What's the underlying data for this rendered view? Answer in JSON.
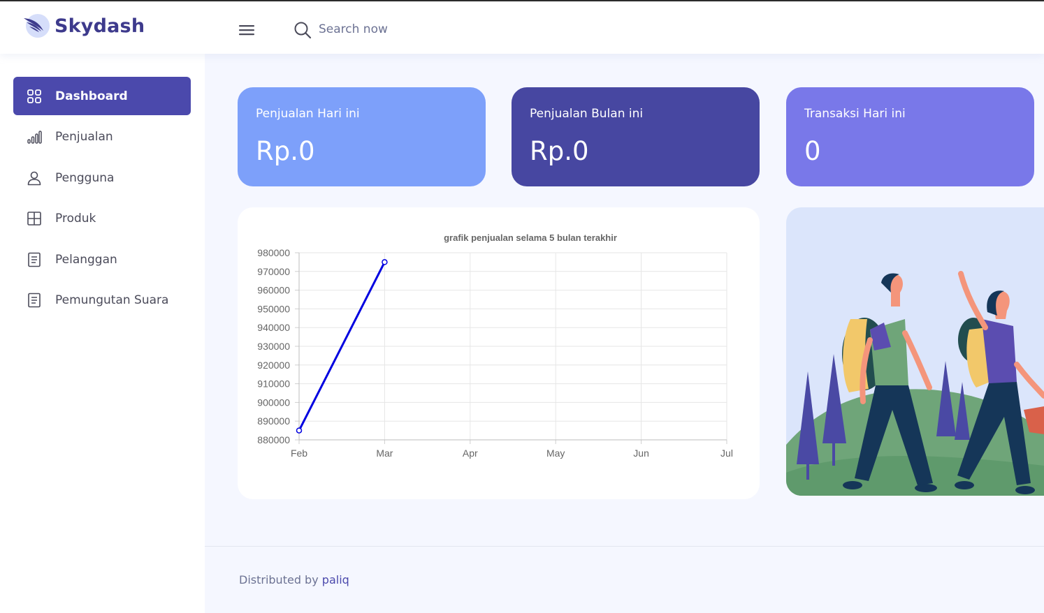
{
  "brand": {
    "name": "Skydash"
  },
  "search": {
    "placeholder": "Search now"
  },
  "sidebar": {
    "items": [
      {
        "label": "Dashboard",
        "icon": "grid-icon",
        "active": true
      },
      {
        "label": "Penjualan",
        "icon": "bar-chart-icon",
        "active": false
      },
      {
        "label": "Pengguna",
        "icon": "user-icon",
        "active": false
      },
      {
        "label": "Produk",
        "icon": "table-icon",
        "active": false
      },
      {
        "label": "Pelanggan",
        "icon": "document-icon",
        "active": false
      },
      {
        "label": "Pemungutan Suara",
        "icon": "document-icon",
        "active": false
      }
    ]
  },
  "cards": [
    {
      "title": "Penjualan Hari ini",
      "value": "Rp.0",
      "color": "#7da0fa"
    },
    {
      "title": "Penjualan Bulan ini",
      "value": "Rp.0",
      "color": "#4747a1"
    },
    {
      "title": "Transaksi Hari ini",
      "value": "0",
      "color": "#7978e9"
    }
  ],
  "chart_data": {
    "type": "line",
    "title": "grafik penjualan selama 5 bulan terakhir",
    "categories": [
      "Feb",
      "Mar",
      "Apr",
      "May",
      "Jun",
      "Jul"
    ],
    "series": [
      {
        "values": [
          885000,
          975000
        ],
        "color": "#0000e0"
      }
    ],
    "ylim": [
      880000,
      980000
    ],
    "yticks": [
      980000,
      970000,
      960000,
      950000,
      940000,
      930000,
      920000,
      910000,
      900000,
      890000,
      880000
    ],
    "grid": true
  },
  "footer": {
    "prefix": "Distributed by",
    "link": "paliq"
  }
}
